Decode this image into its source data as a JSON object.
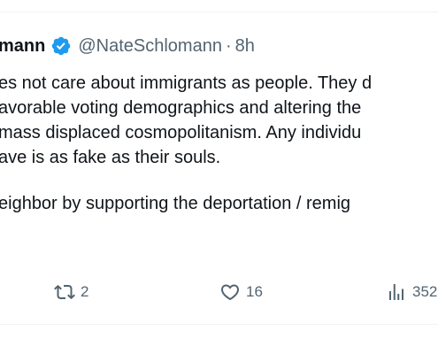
{
  "tweet": {
    "display_name": "mann",
    "handle": "@NateSchlomann",
    "separator": "·",
    "time": "8h",
    "lines": [
      "es not care about immigrants as people. They d",
      "avorable voting demographics and altering the",
      "mass displaced cosmopolitanism. Any individu",
      "ave is as fake as their souls.",
      "eighbor by supporting the deportation / remig"
    ]
  },
  "actions": {
    "retweet_count": "2",
    "like_count": "16",
    "views_count": "352"
  },
  "colors": {
    "verified_badge": "#1d9bf0",
    "secondary_text": "#536471",
    "primary_text": "#0f1419",
    "divider": "#eff3f4"
  },
  "icons": [
    "verified-icon",
    "retweet-icon",
    "like-icon",
    "views-icon"
  ]
}
